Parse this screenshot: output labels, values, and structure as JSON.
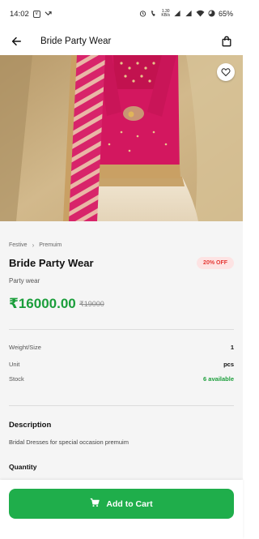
{
  "status_bar": {
    "time": "14:02",
    "left_icons": [
      "sim-badge-icon",
      "missed-call-icon"
    ],
    "net_speed": "1.30\nKB/s",
    "battery": "65%"
  },
  "app_bar": {
    "title": "Bride Party Wear",
    "back_icon": "arrow-left-icon",
    "bag_icon": "shopping-bag-icon"
  },
  "product": {
    "breadcrumb": [
      "Festive",
      "Premuim"
    ],
    "title": "Bride Party Wear",
    "discount": "20% OFF",
    "subtitle": "Party wear",
    "price": "₹16000.00",
    "mrp": "₹19000",
    "specs": [
      {
        "label": "Weight/Size",
        "value": "1"
      },
      {
        "label": "Unit",
        "value": "pcs"
      },
      {
        "label": "Stock",
        "value": "6 available"
      }
    ],
    "description_title": "Description",
    "description": "Bridal Dresses for special occasion premuim",
    "quantity_title": "Quantity"
  },
  "cart_button": {
    "label": "Add to Cart",
    "icon": "cart-icon"
  },
  "colors": {
    "accent_green": "#1fae4b",
    "price_green": "#1b9e3b",
    "badge_bg": "#fde3e3",
    "badge_text": "#e53935"
  }
}
